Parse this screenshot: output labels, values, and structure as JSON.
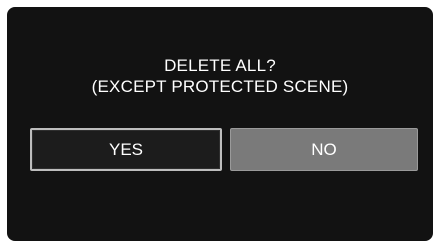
{
  "dialog": {
    "line1": "DELETE ALL?",
    "line2": "(EXCEPT PROTECTED SCENE)"
  },
  "buttons": {
    "yes_label": "YES",
    "no_label": "NO"
  },
  "colors": {
    "screen_background": "#121212",
    "yes_button_background": "#1c1c1c",
    "yes_button_border": "#bdbdbd",
    "no_button_background": "#7a7a7a",
    "text": "#ffffff"
  }
}
